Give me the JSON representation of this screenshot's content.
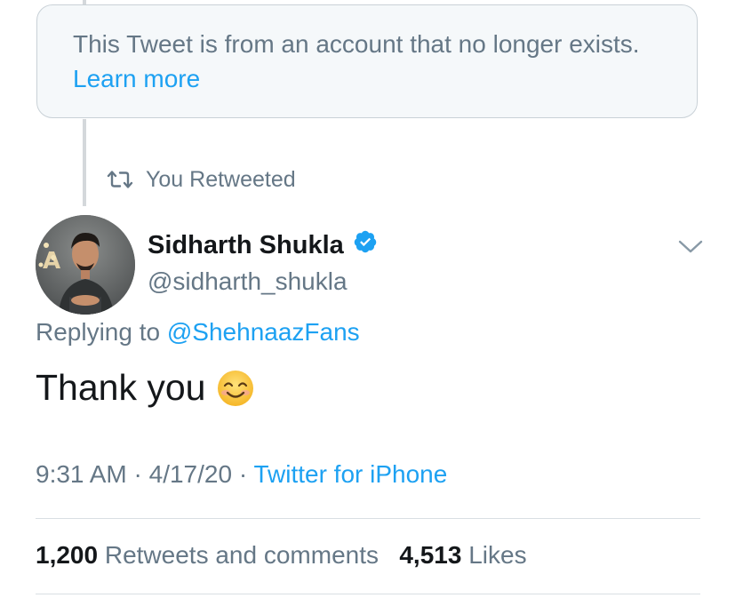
{
  "tombstone": {
    "message": "This Tweet is from an account that no longer exists.",
    "learn_more": "Learn more"
  },
  "retweet": {
    "icon": "retweet-icon",
    "label": "You Retweeted"
  },
  "author": {
    "name": "Sidharth Shukla",
    "handle": "@sidharth_shukla",
    "verified_icon": "verified-badge-icon",
    "menu_icon": "chevron-down-icon"
  },
  "reply": {
    "prefix": "Replying to",
    "mention": "@ShehnaazFans"
  },
  "tweet": {
    "text": "Thank you",
    "emoji": "smiling-face-emoji"
  },
  "meta": {
    "time": "9:31 AM",
    "separator": "·",
    "date": "4/17/20",
    "source": "Twitter for iPhone"
  },
  "stats": {
    "retweets_count": "1,200",
    "retweets_label": "Retweets and comments",
    "likes_count": "4,513",
    "likes_label": "Likes"
  },
  "colors": {
    "accent": "#1da1f2",
    "secondary_text": "#657786",
    "primary_text": "#14171a",
    "verified": "#1da1f2"
  }
}
